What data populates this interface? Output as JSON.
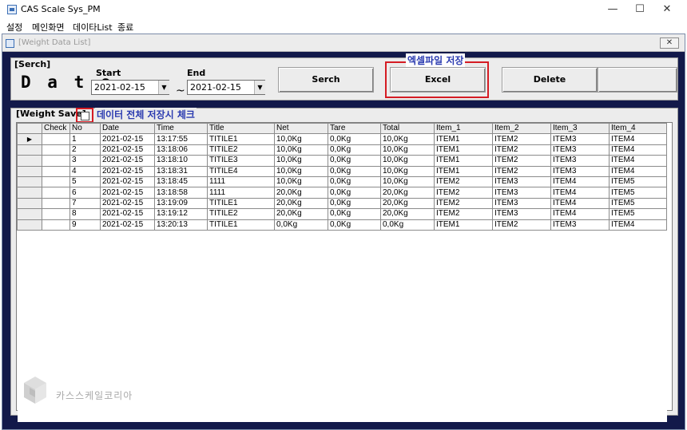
{
  "app": {
    "title": "CAS Scale Sys_PM",
    "icon": "scale-app-icon"
  },
  "window_controls": {
    "minimize": "—",
    "maximize": "☐",
    "close": "✕"
  },
  "menu": {
    "items": [
      "설정",
      "메인화면",
      "데이타List",
      "종료"
    ]
  },
  "child_window": {
    "title": "[Weight Data List]",
    "close": "✕"
  },
  "search": {
    "group_label": "[Serch]",
    "date_label": "D a t e",
    "start_label": "Start",
    "start_value": "2021-02-15",
    "end_label": "End",
    "end_value": "2021-02-15",
    "separator": "~",
    "buttons": {
      "search": "Serch",
      "excel": "Excel",
      "delete": "Delete",
      "blank": ""
    },
    "excel_annotation": "엑셀파일 저장"
  },
  "weight_save": {
    "group_label": "[Weight Save]",
    "checkbox_checked": false,
    "checkbox_annotation": "데이터 전체 저장시 체크"
  },
  "grid": {
    "columns": [
      "Check",
      "No",
      "Date",
      "Time",
      "Title",
      "Net",
      "Tare",
      "Total",
      "Item_1",
      "Item_2",
      "Item_3",
      "Item_4"
    ],
    "current_row_marker": "▶",
    "rows": [
      [
        "",
        "1",
        "2021-02-15",
        "13:17:55",
        "TITILE1",
        "10,0Kg",
        "0,0Kg",
        "10,0Kg",
        "ITEM1",
        "ITEM2",
        "ITEM3",
        "ITEM4"
      ],
      [
        "",
        "2",
        "2021-02-15",
        "13:18:06",
        "TITILE2",
        "10,0Kg",
        "0,0Kg",
        "10,0Kg",
        "ITEM1",
        "ITEM2",
        "ITEM3",
        "ITEM4"
      ],
      [
        "",
        "3",
        "2021-02-15",
        "13:18:10",
        "TITILE3",
        "10,0Kg",
        "0,0Kg",
        "10,0Kg",
        "ITEM1",
        "ITEM2",
        "ITEM3",
        "ITEM4"
      ],
      [
        "",
        "4",
        "2021-02-15",
        "13:18:31",
        "TITILE4",
        "10,0Kg",
        "0,0Kg",
        "10,0Kg",
        "ITEM1",
        "ITEM2",
        "ITEM3",
        "ITEM4"
      ],
      [
        "",
        "5",
        "2021-02-15",
        "13:18:45",
        "1111",
        "10,0Kg",
        "0,0Kg",
        "10,0Kg",
        "ITEM2",
        "ITEM3",
        "ITEM4",
        "ITEM5"
      ],
      [
        "",
        "6",
        "2021-02-15",
        "13:18:58",
        "1111",
        "20,0Kg",
        "0,0Kg",
        "20,0Kg",
        "ITEM2",
        "ITEM3",
        "ITEM4",
        "ITEM5"
      ],
      [
        "",
        "7",
        "2021-02-15",
        "13:19:09",
        "TITILE1",
        "20,0Kg",
        "0,0Kg",
        "20,0Kg",
        "ITEM2",
        "ITEM3",
        "ITEM4",
        "ITEM5"
      ],
      [
        "",
        "8",
        "2021-02-15",
        "13:19:12",
        "TITILE2",
        "20,0Kg",
        "0,0Kg",
        "20,0Kg",
        "ITEM2",
        "ITEM3",
        "ITEM4",
        "ITEM5"
      ],
      [
        "",
        "9",
        "2021-02-15",
        "13:20:13",
        "TITILE1",
        "0,0Kg",
        "0,0Kg",
        "0,0Kg",
        "ITEM1",
        "ITEM2",
        "ITEM3",
        "ITEM4"
      ]
    ]
  },
  "watermark": {
    "text": "카스스케일코리아",
    "icon": "cube-logo-icon"
  },
  "colors": {
    "frame": "#12194a",
    "panel": "#ececec",
    "annotation_border": "#d51c24",
    "annotation_text": "#2b3bb0"
  }
}
